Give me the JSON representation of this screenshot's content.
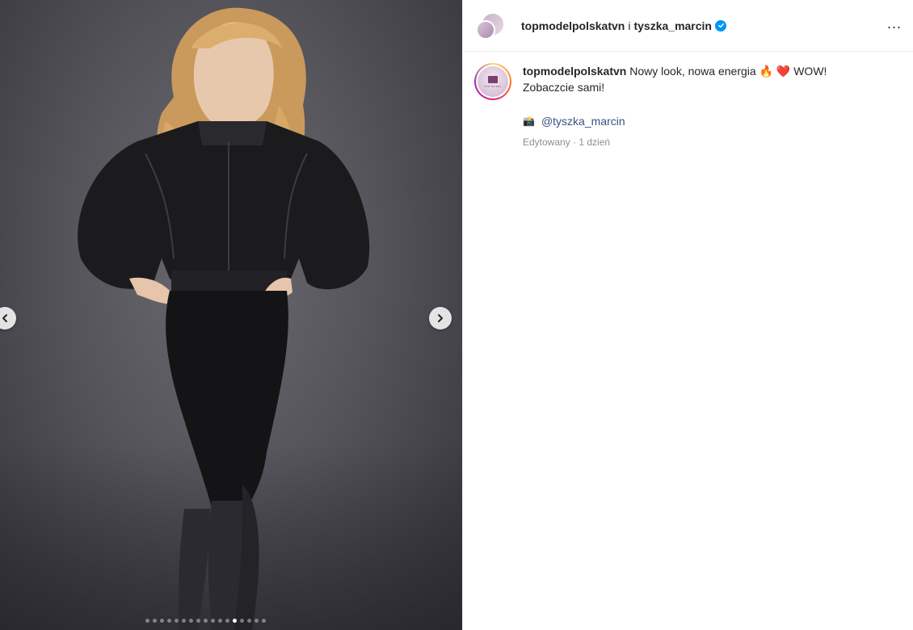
{
  "post": {
    "dots_total": 17,
    "dots_active_index": 12
  },
  "header": {
    "account": "topmodelpolskatvn",
    "separator": "i",
    "collaborator": "tyszka_marcin",
    "more": "..."
  },
  "caption": {
    "username": "topmodelpolskatvn",
    "text": "Nowy look, nowa energia",
    "emoji_fire": "🔥",
    "emoji_heart": "❤️",
    "text_after": "WOW! Zobaczcie sami!",
    "camera_emoji": "📸",
    "mention": "@tyszka_marcin",
    "meta": "Edytowany · 1 dzień"
  },
  "colors": {
    "accent_link": "#385185",
    "verified": "#0095f6"
  }
}
